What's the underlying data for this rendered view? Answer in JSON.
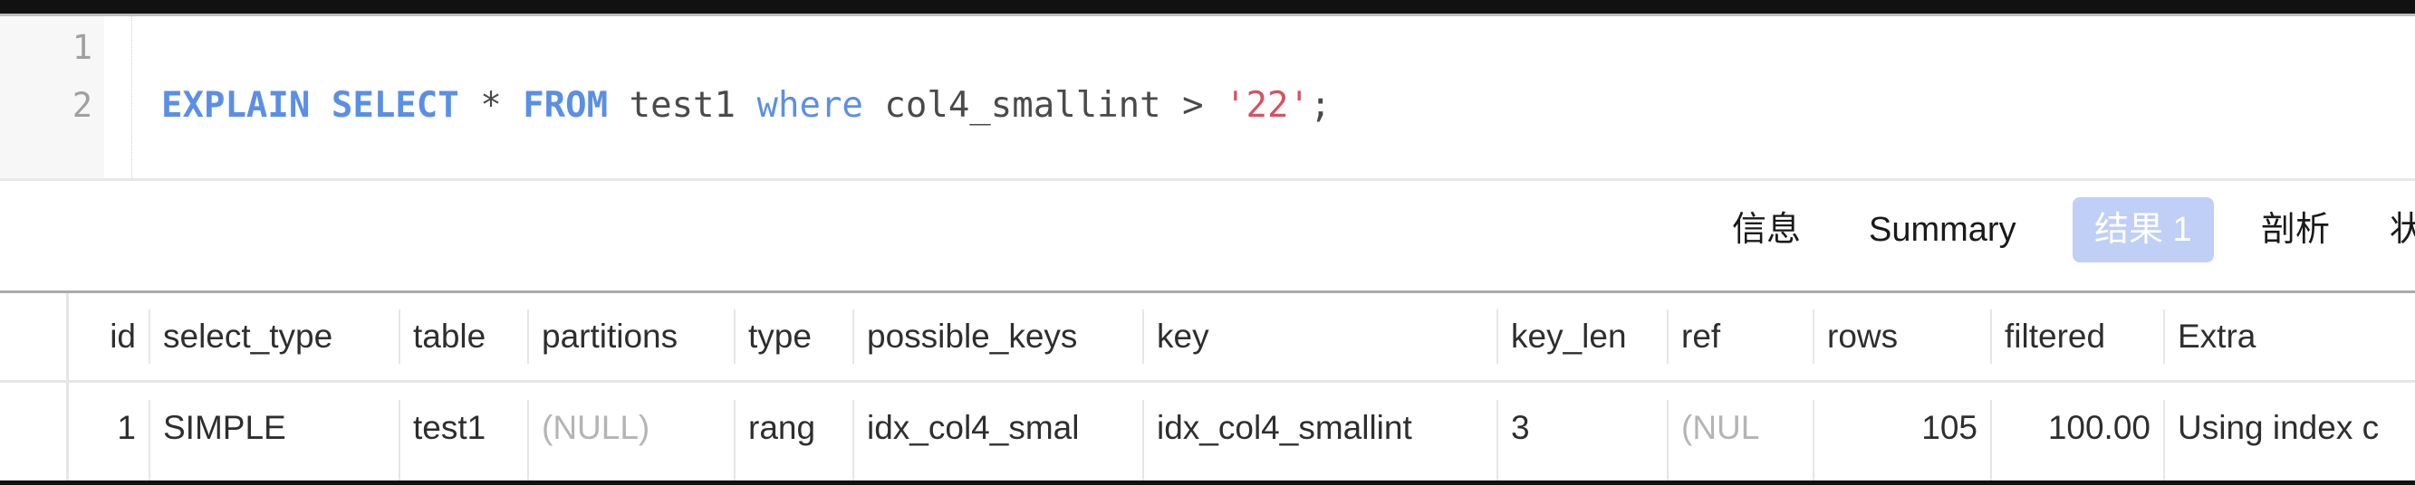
{
  "editor": {
    "line_numbers": [
      "1",
      "2"
    ],
    "line1": "",
    "line2": {
      "kw_explain": "EXPLAIN",
      "kw_select": "SELECT",
      "star": " * ",
      "kw_from": "FROM",
      "table": " test1 ",
      "kw_where": "where",
      "column": " col4_smallint > ",
      "value": "'22'",
      "end": ";"
    },
    "colors": {
      "keyword": "#5b8fe6",
      "string": "#d9505f",
      "text": "#4a4a4a"
    }
  },
  "tabs": [
    {
      "label": "信息",
      "active": false
    },
    {
      "label": "Summary",
      "active": false
    },
    {
      "label": "结果 1",
      "active": true
    },
    {
      "label": "剖析",
      "active": false
    },
    {
      "label": "状",
      "active": false
    }
  ],
  "tab_active_color": "#bfcff5",
  "result_table": {
    "columns": [
      "id",
      "select_type",
      "table",
      "partitions",
      "type",
      "possible_keys",
      "key",
      "key_len",
      "ref",
      "rows",
      "filtered",
      "Extra"
    ],
    "rows": [
      [
        "1",
        "SIMPLE",
        "test1",
        "(NULL)",
        "rang",
        "idx_col4_smal",
        "idx_col4_smallint",
        "3",
        "(NUL",
        "105",
        "100.00",
        "Using index c"
      ]
    ]
  }
}
